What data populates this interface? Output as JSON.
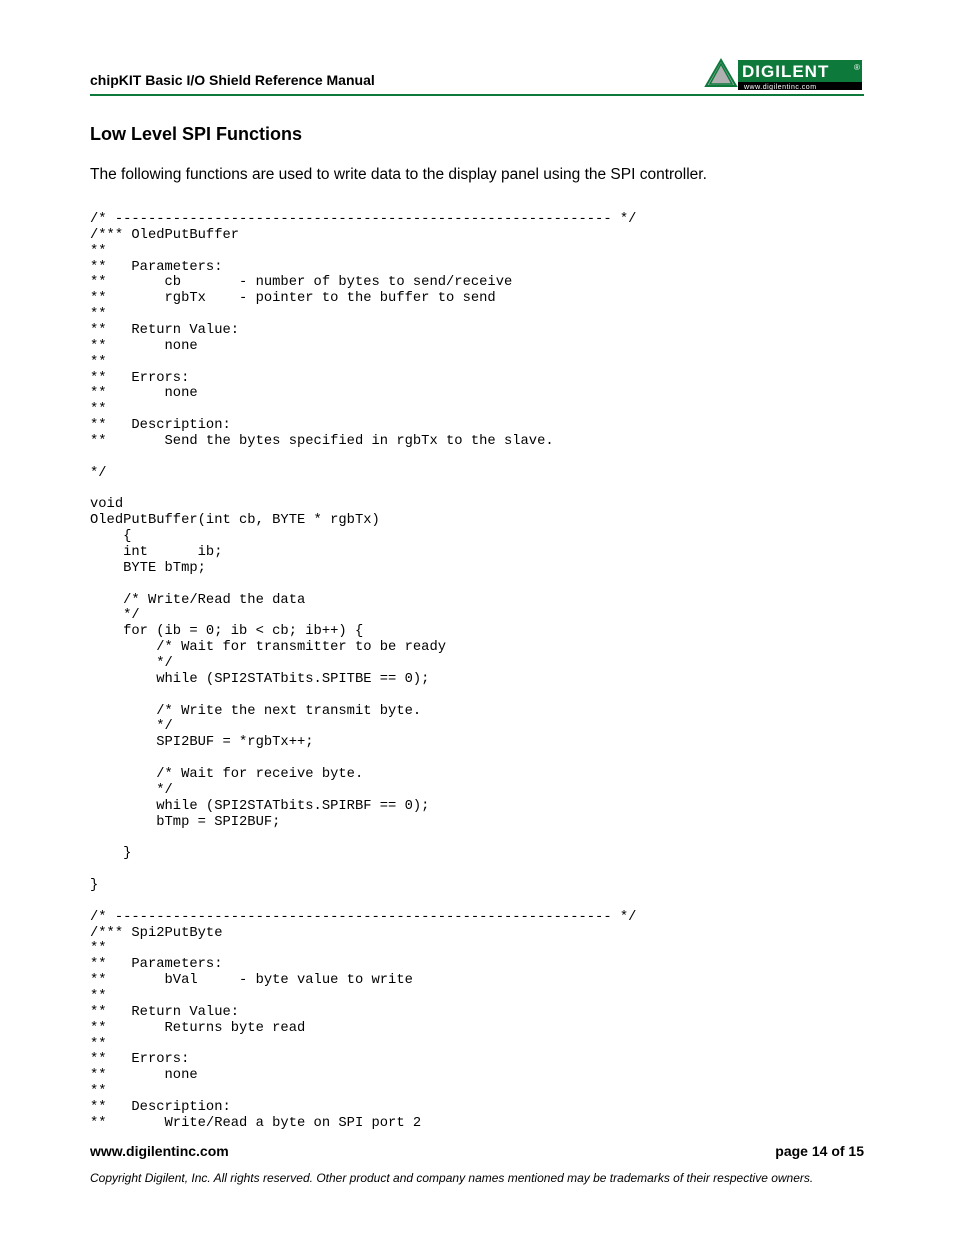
{
  "header": {
    "doc_title": "chipKIT Basic I/O Shield Reference Manual",
    "logo_text": "DIGILENT",
    "logo_url": "www.digilentinc.com"
  },
  "body": {
    "section_heading": "Low Level SPI Functions",
    "intro": "The following functions are used to write data to the display panel using the SPI controller.",
    "code": "/* ------------------------------------------------------------ */\n/*** OledPutBuffer\n**\n**   Parameters:\n**       cb       - number of bytes to send/receive\n**       rgbTx    - pointer to the buffer to send\n**\n**   Return Value:\n**       none\n**\n**   Errors:\n**       none\n**\n**   Description:\n**       Send the bytes specified in rgbTx to the slave.\n\n*/\n\nvoid\nOledPutBuffer(int cb, BYTE * rgbTx)\n    {\n    int      ib;\n    BYTE bTmp;\n\n    /* Write/Read the data\n    */\n    for (ib = 0; ib < cb; ib++) {\n        /* Wait for transmitter to be ready\n        */\n        while (SPI2STATbits.SPITBE == 0);\n\n        /* Write the next transmit byte.\n        */\n        SPI2BUF = *rgbTx++;\n\n        /* Wait for receive byte.\n        */\n        while (SPI2STATbits.SPIRBF == 0);\n        bTmp = SPI2BUF;\n\n    }\n\n}\n\n/* ------------------------------------------------------------ */\n/*** Spi2PutByte\n**\n**   Parameters:\n**       bVal     - byte value to write\n**\n**   Return Value:\n**       Returns byte read\n**\n**   Errors:\n**       none\n**\n**   Description:\n**       Write/Read a byte on SPI port 2"
  },
  "footer": {
    "site": "www.digilentinc.com",
    "page": "page 14 of 15",
    "copyright": "Copyright Digilent, Inc. All rights reserved. Other product and company names mentioned may be trademarks of their respective owners."
  }
}
